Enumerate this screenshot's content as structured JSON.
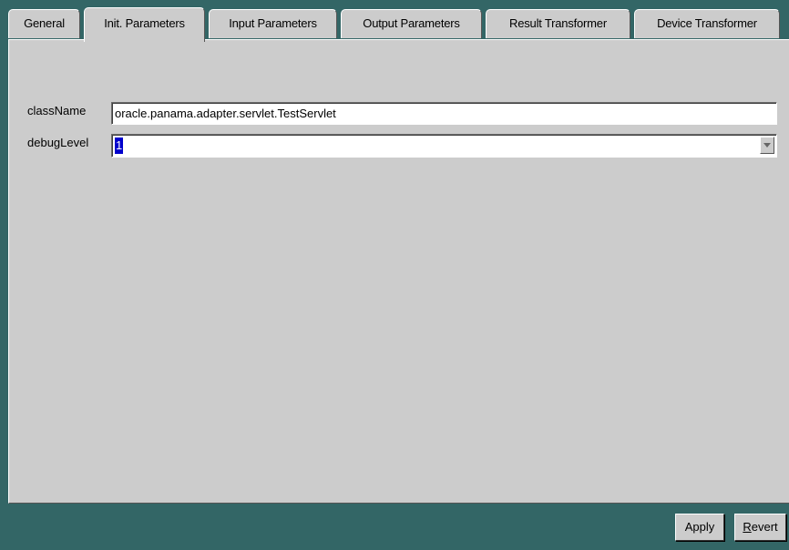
{
  "tabs": [
    {
      "label": "General",
      "selected": false
    },
    {
      "label": "Init. Parameters",
      "selected": true
    },
    {
      "label": "Input Parameters",
      "selected": false
    },
    {
      "label": "Output Parameters",
      "selected": false
    },
    {
      "label": "Result Transformer",
      "selected": false
    },
    {
      "label": "Device Transformer",
      "selected": false
    }
  ],
  "form": {
    "classname_label": "className",
    "classname_value": "oracle.panama.adapter.servlet.TestServlet",
    "debuglevel_label": "debugLevel",
    "debuglevel_value": "1",
    "debuglevel_dropdown_icon": "chevron-down-icon"
  },
  "buttons": {
    "apply_label": "Apply",
    "revert_mnemonic": "R",
    "revert_rest": "evert"
  },
  "colors": {
    "window_background": "#336666",
    "panel_background": "#cccccc",
    "selection_highlight": "#0000cc"
  }
}
